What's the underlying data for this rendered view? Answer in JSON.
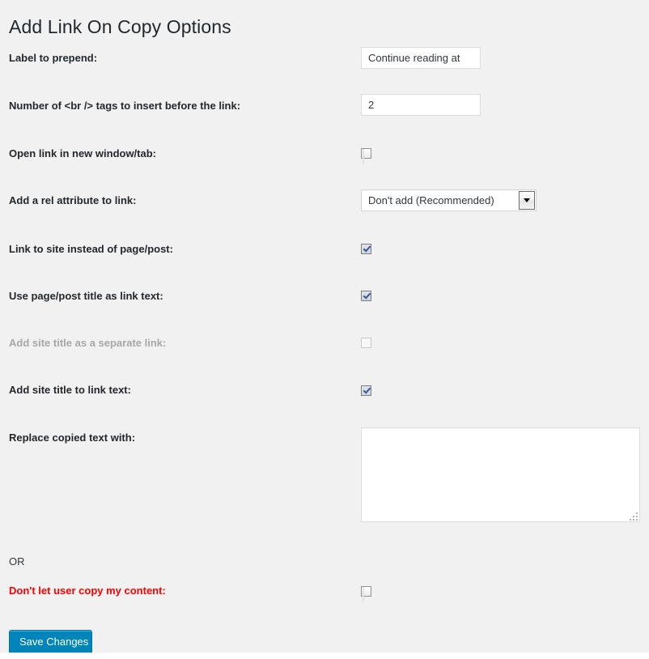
{
  "page": {
    "title": "Add Link On Copy Options",
    "background_color": "#f1f1f1"
  },
  "fields": {
    "label_to_prepend": {
      "label": "Label to prepend:",
      "type": "text",
      "value": "Continue reading at",
      "placeholder": ""
    },
    "br_tags_count": {
      "label": "Number of <br /> tags to insert before the link:",
      "type": "text",
      "value": "2",
      "placeholder": ""
    },
    "open_in_new_window": {
      "label": "Open link in new window/tab:",
      "type": "checkbox",
      "checked": false,
      "disabled": false
    },
    "rel_attribute": {
      "label": "Add a rel attribute to link:",
      "type": "select",
      "value": "Don't add (Recommended)",
      "options": [
        "Don't add (Recommended)"
      ]
    },
    "link_to_site": {
      "label": "Link to site instead of page/post:",
      "type": "checkbox",
      "checked": true,
      "disabled": false
    },
    "use_title_as_link_text": {
      "label": "Use page/post title as link text:",
      "type": "checkbox",
      "checked": true,
      "disabled": false
    },
    "site_title_separate_link": {
      "label": "Add site title as a separate link:",
      "type": "checkbox",
      "checked": false,
      "disabled": true
    },
    "site_title_to_link_text": {
      "label": "Add site title to link text:",
      "type": "checkbox",
      "checked": true,
      "disabled": false
    },
    "replace_copied_text": {
      "label": "Replace copied text with:",
      "type": "textarea",
      "value": "",
      "placeholder": ""
    },
    "or_separator": {
      "label": "OR"
    },
    "disallow_copy": {
      "label": "Don't let user copy my content:",
      "type": "checkbox",
      "checked": false,
      "disabled": false,
      "color": "#ff0000"
    }
  },
  "actions": {
    "save_label": "Save Changes",
    "save_color": "#0085ba"
  }
}
